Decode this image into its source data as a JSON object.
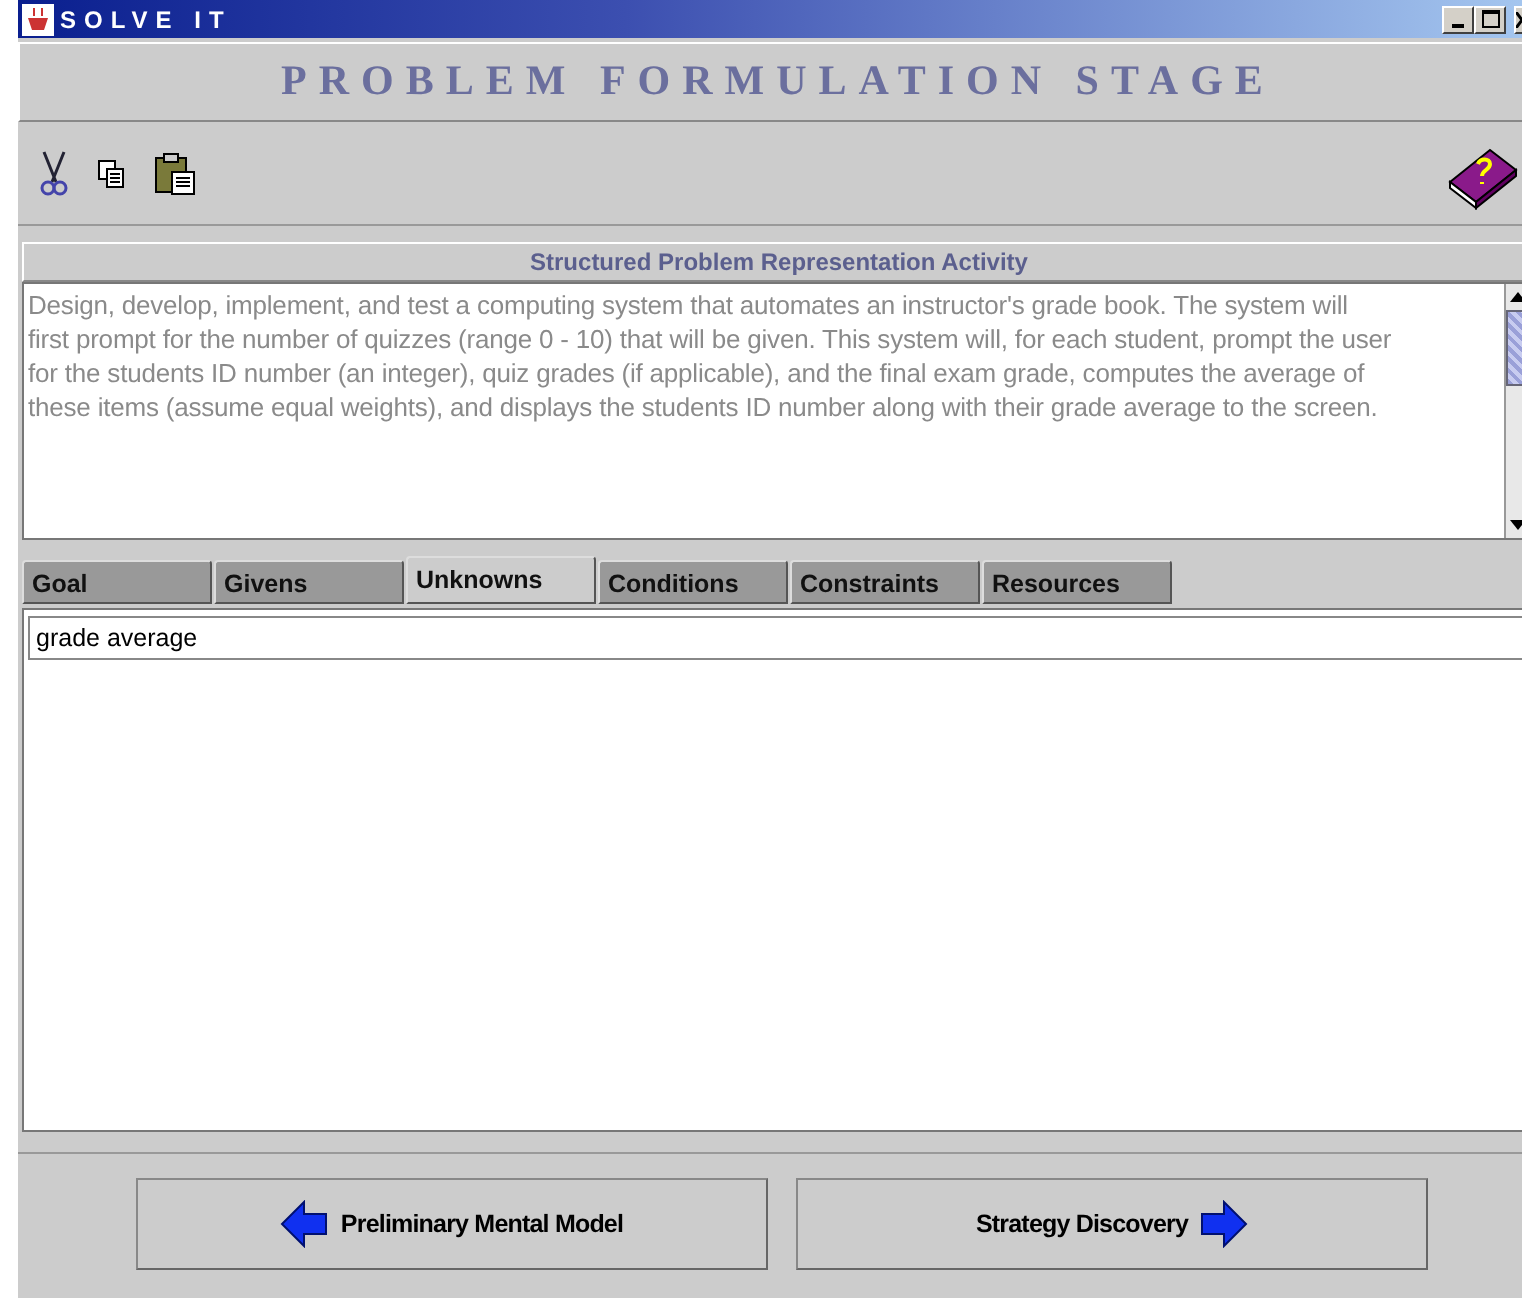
{
  "window": {
    "title": "SOLVE IT"
  },
  "stage_title": "PROBLEM FORMULATION STAGE",
  "activity": {
    "title": "Structured Problem Representation Activity",
    "text": "Design, develop, implement, and test a computing system that automates an instructor's grade book. The system will first prompt for the number of quizzes (range 0 - 10) that will be given. This system will, for each student, prompt the user for the students ID number (an integer), quiz grades (if applicable), and the final exam grade, computes the average of these items (assume equal weights), and displays the students ID number along with their grade average to the screen."
  },
  "tabs": [
    {
      "label": "Goal",
      "selected": false
    },
    {
      "label": "Givens",
      "selected": false
    },
    {
      "label": "Unknowns",
      "selected": true
    },
    {
      "label": "Conditions",
      "selected": false
    },
    {
      "label": "Constraints",
      "selected": false
    },
    {
      "label": "Resources",
      "selected": false
    }
  ],
  "entry": {
    "value": "grade average"
  },
  "buttons": [
    {
      "label": "Preliminary Mental Model",
      "kind": "back"
    },
    {
      "label": "Strategy Discovery",
      "kind": "next"
    }
  ]
}
